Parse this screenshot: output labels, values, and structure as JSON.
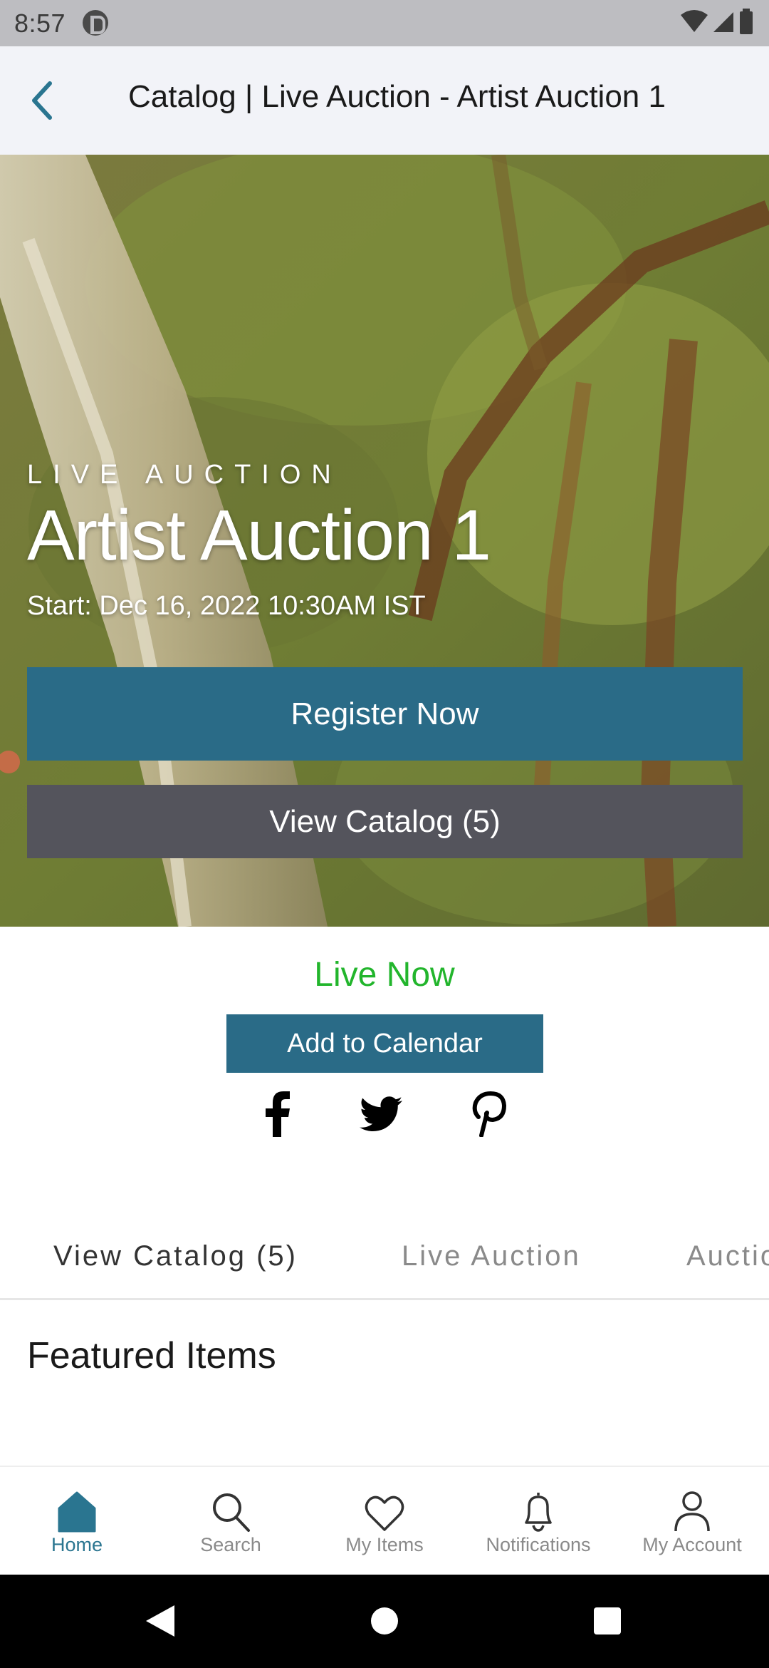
{
  "status_bar": {
    "time": "8:57"
  },
  "app_bar": {
    "title": "Catalog | Live Auction - Artist Auction 1"
  },
  "hero": {
    "eyebrow": "LIVE AUCTION",
    "title": "Artist Auction 1",
    "start": "Start: Dec 16, 2022 10:30AM IST",
    "register_label": "Register Now",
    "view_catalog_label": "View Catalog (5)"
  },
  "status": {
    "live_now": "Live Now",
    "add_to_calendar": "Add to Calendar"
  },
  "social": [
    "facebook-icon",
    "twitter-icon",
    "pinterest-icon"
  ],
  "tabs": [
    {
      "label": "View Catalog (5)",
      "active": true
    },
    {
      "label": "Live Auction",
      "active": false
    },
    {
      "label": "Auctio",
      "active": false
    }
  ],
  "featured": {
    "heading": "Featured Items"
  },
  "bottom_nav": [
    {
      "label": "Home",
      "icon": "home-icon",
      "active": true
    },
    {
      "label": "Search",
      "icon": "search-icon",
      "active": false
    },
    {
      "label": "My Items",
      "icon": "heart-icon",
      "active": false
    },
    {
      "label": "Notifications",
      "icon": "bell-icon",
      "active": false
    },
    {
      "label": "My Account",
      "icon": "person-icon",
      "active": false
    }
  ],
  "colors": {
    "accent": "#2a6b87",
    "live": "#22b52c",
    "dark_button": "#54545c"
  }
}
